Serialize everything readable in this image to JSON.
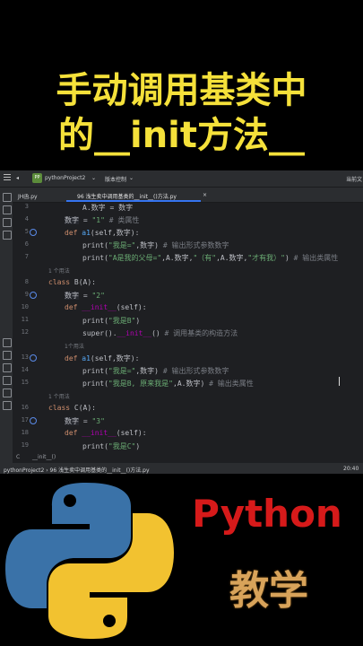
{
  "overlay": {
    "line1": "手动调用基类中",
    "line2": "的__init方法__"
  },
  "ide": {
    "project_name": "pythonProject2",
    "vcs_label": "版本控制",
    "right_label": "当前文",
    "tabs": [
      {
        "label": "JH函.py"
      },
      {
        "label": "96 浅生卖中调用基类的__init__()方法.py"
      }
    ],
    "gutter_lines": [
      "3",
      "4",
      "5",
      "6",
      "7",
      "",
      "8",
      "9",
      "10",
      "11",
      "12",
      "",
      "13",
      "14",
      "15",
      "",
      "16",
      "17",
      "18",
      "19"
    ],
    "hints": {
      "usages_1": "1 个用法",
      "usages_2": "1个用法",
      "usages_3": "1 个用法"
    },
    "code": {
      "l3": "A.数字 = 数字",
      "l4_a": "数字",
      "l4_b": " = ",
      "l4_c": "\"1\"",
      "l4_d": " # 类属性",
      "l5_a": "def ",
      "l5_b": "a1",
      "l5_c": "(self,数字):",
      "l6_a": "print(",
      "l6_b": "\"我是=\"",
      "l6_c": ",数字)",
      "l6_d": " # 输出形式参数数字",
      "l7_a": "print(",
      "l7_b": "\"A是我的父母=\"",
      "l7_c": ",A.数字,",
      "l7_d": "\"（有\"",
      "l7_e": ",A.数字,",
      "l7_f": "\"才有我）\"",
      "l7_g": ")",
      "l7_h": " # 输出类属性",
      "l8_a": "class ",
      "l8_b": "B(A):",
      "l9_a": "数字",
      "l9_b": " = ",
      "l9_c": "\"2\"",
      "l10_a": "def ",
      "l10_b": "__init__",
      "l10_c": "(self):",
      "l11_a": "print(",
      "l11_b": "\"我是B\"",
      "l11_c": ")",
      "l12_a": "super().",
      "l12_b": "__init__",
      "l12_c": "()",
      "l12_d": " # 调用基类的构造方法",
      "l13_a": "def ",
      "l13_b": "a1",
      "l13_c": "(self,数字):",
      "l14_a": "print(",
      "l14_b": "\"我是=\"",
      "l14_c": ",数字)",
      "l14_d": " # 输出形式参数数字",
      "l15_a": "print(",
      "l15_b": "\"我是B, 原来我是\"",
      "l15_c": ",A.数字)",
      "l15_d": " # 输出类属性",
      "l16_a": "class ",
      "l16_b": "C(A):",
      "l17_a": "数字",
      "l17_b": " = ",
      "l17_c": "\"3\"",
      "l18_a": "def ",
      "l18_b": "__init__",
      "l18_c": "(self):",
      "l19_a": "print(",
      "l19_b": "\"我是C\"",
      "l19_c": ")"
    },
    "breadcrumb": "__init__()",
    "breadcrumb_prefix": "C",
    "status_left": "pythonProject2 › 96 浅生卖中调用基类的__init__()方法.py",
    "status_right": "20:40"
  },
  "banner": {
    "python_text": "Python",
    "edu_text": "教学"
  },
  "colors": {
    "title_yellow": "#f5e13a",
    "python_red": "#d61a1a",
    "edu_gold": "#d8a35a",
    "logo_blue": "#3a72a8",
    "logo_yellow": "#f2c230"
  }
}
